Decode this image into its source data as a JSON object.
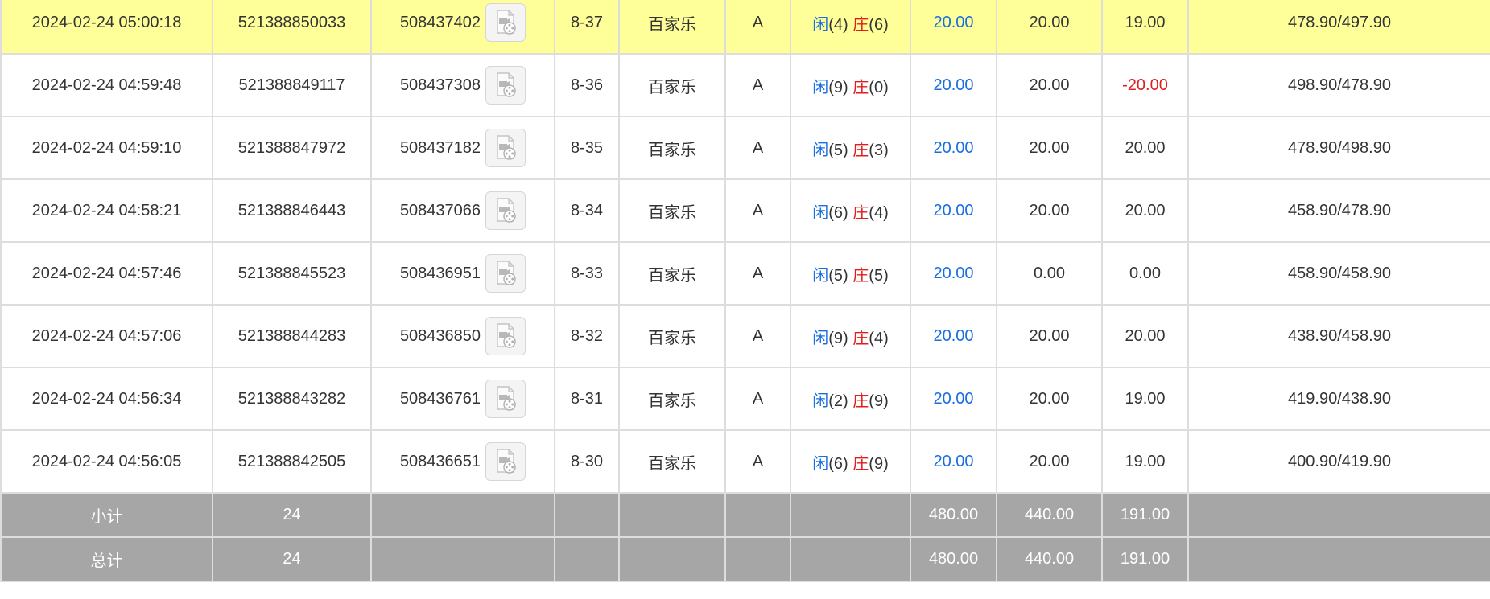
{
  "colors": {
    "player": "#1a6fe0",
    "banker": "#e01e1e",
    "highlight": "#ffff99",
    "summary_bg": "#a6a6a6"
  },
  "rows": [
    {
      "time": "2024-02-24 05:00:18",
      "order_no": "521388850033",
      "game_no": "508437402",
      "icon": "video-replay-icon",
      "round": "8-37",
      "game": "百家乐",
      "table": "A",
      "player_label": "闲",
      "player_points": "(4)",
      "banker_label": "庄",
      "banker_points": "(6)",
      "bet": "20.00",
      "valid_bet": "20.00",
      "win_loss": "19.00",
      "balance": "478.90/497.90",
      "highlighted": true
    },
    {
      "time": "2024-02-24 04:59:48",
      "order_no": "521388849117",
      "game_no": "508437308",
      "icon": "video-replay-icon",
      "round": "8-36",
      "game": "百家乐",
      "table": "A",
      "player_label": "闲",
      "player_points": "(9)",
      "banker_label": "庄",
      "banker_points": "(0)",
      "bet": "20.00",
      "valid_bet": "20.00",
      "win_loss": "-20.00",
      "balance": "498.90/478.90",
      "highlighted": false
    },
    {
      "time": "2024-02-24 04:59:10",
      "order_no": "521388847972",
      "game_no": "508437182",
      "icon": "video-replay-icon",
      "round": "8-35",
      "game": "百家乐",
      "table": "A",
      "player_label": "闲",
      "player_points": "(5)",
      "banker_label": "庄",
      "banker_points": "(3)",
      "bet": "20.00",
      "valid_bet": "20.00",
      "win_loss": "20.00",
      "balance": "478.90/498.90",
      "highlighted": false
    },
    {
      "time": "2024-02-24 04:58:21",
      "order_no": "521388846443",
      "game_no": "508437066",
      "icon": "video-replay-icon",
      "round": "8-34",
      "game": "百家乐",
      "table": "A",
      "player_label": "闲",
      "player_points": "(6)",
      "banker_label": "庄",
      "banker_points": "(4)",
      "bet": "20.00",
      "valid_bet": "20.00",
      "win_loss": "20.00",
      "balance": "458.90/478.90",
      "highlighted": false
    },
    {
      "time": "2024-02-24 04:57:46",
      "order_no": "521388845523",
      "game_no": "508436951",
      "icon": "video-replay-icon",
      "round": "8-33",
      "game": "百家乐",
      "table": "A",
      "player_label": "闲",
      "player_points": "(5)",
      "banker_label": "庄",
      "banker_points": "(5)",
      "bet": "20.00",
      "valid_bet": "0.00",
      "win_loss": "0.00",
      "balance": "458.90/458.90",
      "highlighted": false
    },
    {
      "time": "2024-02-24 04:57:06",
      "order_no": "521388844283",
      "game_no": "508436850",
      "icon": "video-replay-icon",
      "round": "8-32",
      "game": "百家乐",
      "table": "A",
      "player_label": "闲",
      "player_points": "(9)",
      "banker_label": "庄",
      "banker_points": "(4)",
      "bet": "20.00",
      "valid_bet": "20.00",
      "win_loss": "20.00",
      "balance": "438.90/458.90",
      "highlighted": false
    },
    {
      "time": "2024-02-24 04:56:34",
      "order_no": "521388843282",
      "game_no": "508436761",
      "icon": "video-replay-icon",
      "round": "8-31",
      "game": "百家乐",
      "table": "A",
      "player_label": "闲",
      "player_points": "(2)",
      "banker_label": "庄",
      "banker_points": "(9)",
      "bet": "20.00",
      "valid_bet": "20.00",
      "win_loss": "19.00",
      "balance": "419.90/438.90",
      "highlighted": false
    },
    {
      "time": "2024-02-24 04:56:05",
      "order_no": "521388842505",
      "game_no": "508436651",
      "icon": "video-replay-icon",
      "round": "8-30",
      "game": "百家乐",
      "table": "A",
      "player_label": "闲",
      "player_points": "(6)",
      "banker_label": "庄",
      "banker_points": "(9)",
      "bet": "20.00",
      "valid_bet": "20.00",
      "win_loss": "19.00",
      "balance": "400.90/419.90",
      "highlighted": false
    }
  ],
  "summary": [
    {
      "label": "小计",
      "count": "24",
      "bet": "480.00",
      "valid_bet": "440.00",
      "win_loss": "191.00"
    },
    {
      "label": "总计",
      "count": "24",
      "bet": "480.00",
      "valid_bet": "440.00",
      "win_loss": "191.00"
    }
  ]
}
